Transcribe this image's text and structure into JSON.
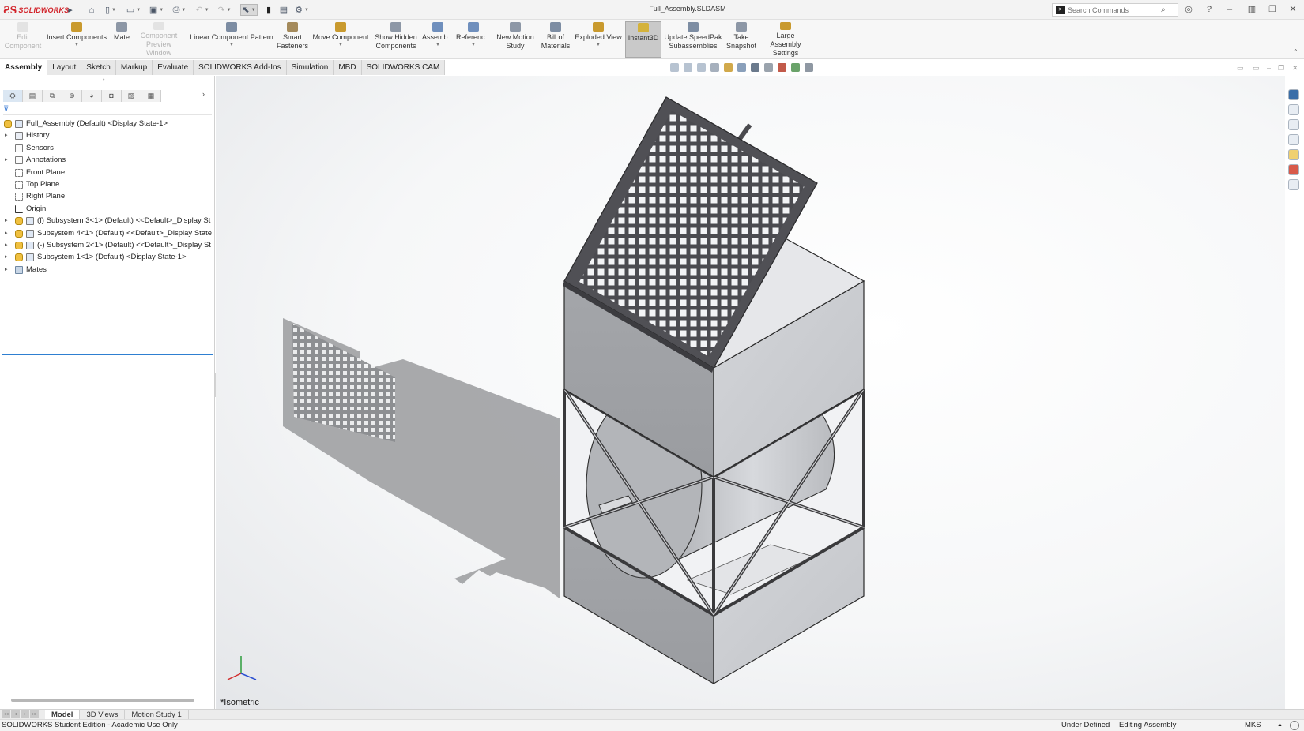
{
  "app": {
    "brand": "SOLIDWORKS",
    "document_title": "Full_Assembly.SLDASM"
  },
  "search": {
    "placeholder": "Search Commands"
  },
  "command_manager": [
    {
      "label": "Edit\nComponent",
      "enabled": false
    },
    {
      "label": "Insert Components",
      "enabled": true
    },
    {
      "label": "Mate",
      "enabled": true
    },
    {
      "label": "Component\nPreview Window",
      "enabled": false
    },
    {
      "label": "Linear Component Pattern",
      "enabled": true
    },
    {
      "label": "Smart\nFasteners",
      "enabled": true
    },
    {
      "label": "Move Component",
      "enabled": true
    },
    {
      "label": "Show Hidden\nComponents",
      "enabled": true
    },
    {
      "label": "Assemb...",
      "enabled": true
    },
    {
      "label": "Referenc...",
      "enabled": true
    },
    {
      "label": "New Motion\nStudy",
      "enabled": true
    },
    {
      "label": "Bill of\nMaterials",
      "enabled": true
    },
    {
      "label": "Exploded View",
      "enabled": true
    },
    {
      "label": "Instant3D",
      "enabled": true,
      "active": true
    },
    {
      "label": "Update SpeedPak\nSubassemblies",
      "enabled": true
    },
    {
      "label": "Take\nSnapshot",
      "enabled": true
    },
    {
      "label": "Large Assembly\nSettings",
      "enabled": true
    }
  ],
  "tabs": [
    "Assembly",
    "Layout",
    "Sketch",
    "Markup",
    "Evaluate",
    "SOLIDWORKS Add-Ins",
    "Simulation",
    "MBD",
    "SOLIDWORKS CAM"
  ],
  "active_tab": "Assembly",
  "feature_tree": [
    {
      "label": "Full_Assembly (Default) <Display State-1>",
      "icon": "assembly-icon",
      "level": 0,
      "expandable": false
    },
    {
      "label": "History",
      "icon": "history-icon",
      "level": 1,
      "expandable": true
    },
    {
      "label": "Sensors",
      "icon": "sensors-icon",
      "level": 1,
      "expandable": false
    },
    {
      "label": "Annotations",
      "icon": "annotations-icon",
      "level": 1,
      "expandable": true
    },
    {
      "label": "Front Plane",
      "icon": "plane-icon",
      "level": 1,
      "expandable": false
    },
    {
      "label": "Top Plane",
      "icon": "plane-icon",
      "level": 1,
      "expandable": false
    },
    {
      "label": "Right Plane",
      "icon": "plane-icon",
      "level": 1,
      "expandable": false
    },
    {
      "label": "Origin",
      "icon": "origin-icon",
      "level": 1,
      "expandable": false
    },
    {
      "label": "(f) Subsystem 3<1> (Default) <<Default>_Display St",
      "icon": "subassembly-icon",
      "level": 1,
      "expandable": true
    },
    {
      "label": "Subsystem 4<1> (Default) <<Default>_Display State",
      "icon": "subassembly-icon",
      "level": 1,
      "expandable": true
    },
    {
      "label": "(-) Subsystem 2<1> (Default) <<Default>_Display St",
      "icon": "subassembly-icon",
      "level": 1,
      "expandable": true
    },
    {
      "label": "Subsystem 1<1> (Default) <Display State-1>",
      "icon": "subassembly-icon",
      "level": 1,
      "expandable": true
    },
    {
      "label": "Mates",
      "icon": "mates-icon",
      "level": 1,
      "expandable": true
    }
  ],
  "viewport": {
    "view_name": "*Isometric"
  },
  "bottom_tabs": [
    "Model",
    "3D Views",
    "Motion Study 1"
  ],
  "active_bottom_tab": "Model",
  "status": {
    "edition": "SOLIDWORKS Student Edition - Academic Use Only",
    "definition": "Under Defined",
    "mode": "Editing Assembly",
    "units": "MKS"
  },
  "colors": {
    "brand_red": "#d2232a",
    "selection_blue": "#2e7fd1"
  }
}
